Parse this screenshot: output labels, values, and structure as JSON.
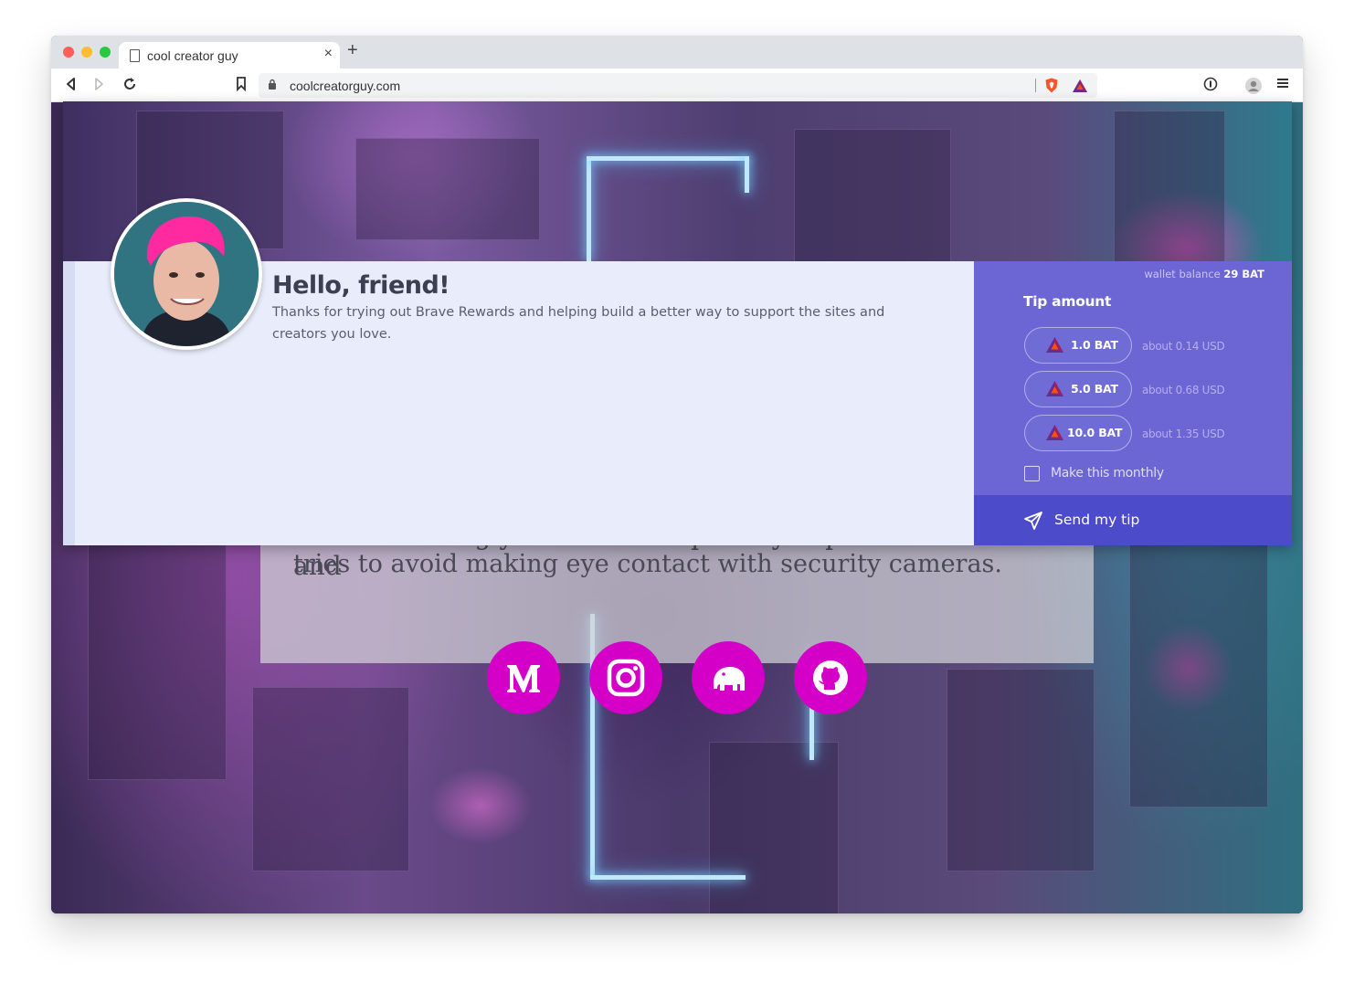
{
  "browser": {
    "tab_title": "cool creator guy",
    "tab_close": "×",
    "new_tab": "+",
    "url": "coolcreatorguy.com"
  },
  "page": {
    "bio_line1": "believes strongly in individual privacy & personal freedom and",
    "bio_line2": "tries to avoid making eye contact with security cameras.",
    "social": [
      "medium-icon",
      "instagram-icon",
      "mastodon-icon",
      "github-icon"
    ],
    "social_color": "#d400c8"
  },
  "rewards_panel": {
    "greeting_title": "Hello, friend!",
    "greeting_text": "Thanks for trying out Brave Rewards and helping build a better way to support the sites and creators you love.",
    "wallet_label": "wallet balance",
    "wallet_value": "29 BAT",
    "tip_title": "Tip amount",
    "amounts": [
      {
        "label": "1.0 BAT",
        "usd": "about 0.14 USD"
      },
      {
        "label": "5.0 BAT",
        "usd": "about 0.68 USD"
      },
      {
        "label": "10.0 BAT",
        "usd": "about 1.35 USD"
      }
    ],
    "monthly_label": "Make this monthly",
    "monthly_checked": false,
    "send_label": "Send my tip",
    "colors": {
      "tip_pane": "#6b66d4",
      "send_bar": "#4c4bc9",
      "content": "#e9edfb"
    }
  }
}
